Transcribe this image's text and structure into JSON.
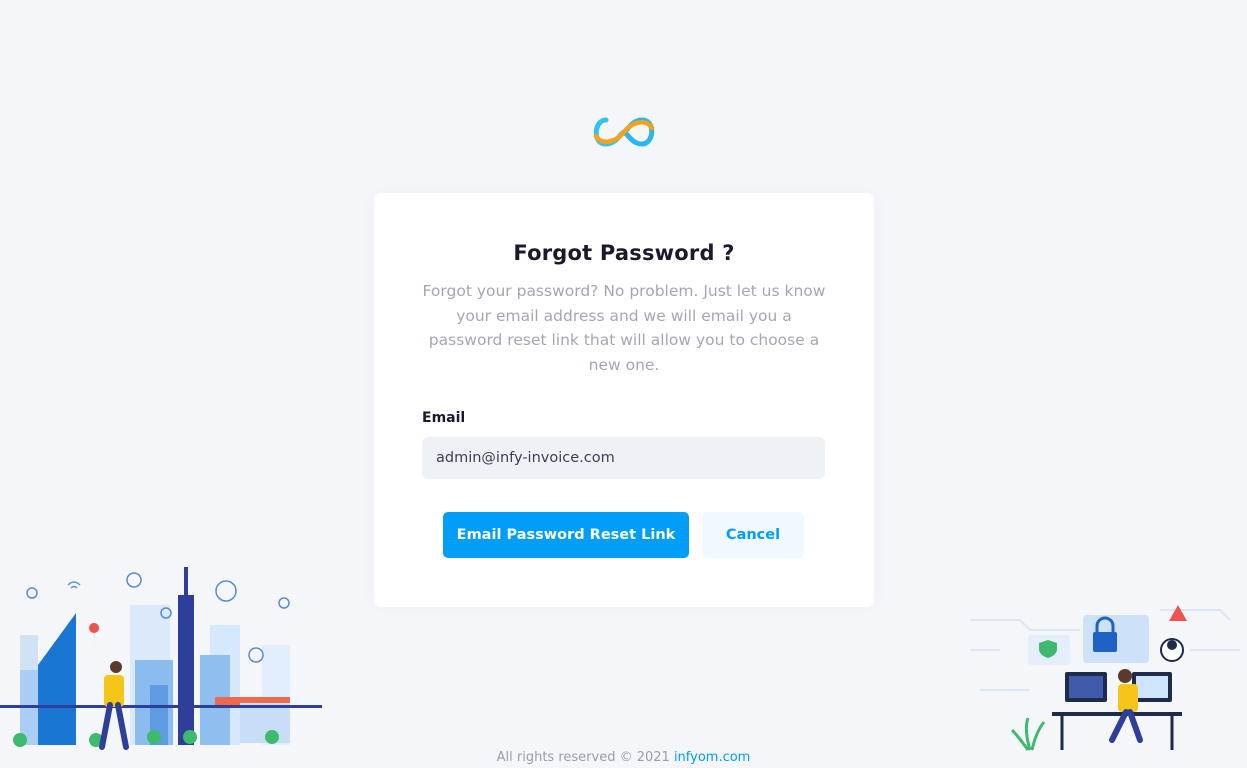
{
  "logo": {
    "icon": "infinity-logo-icon"
  },
  "card": {
    "title": "Forgot Password ?",
    "description": "Forgot your password? No problem. Just let us know your email address and we will email you a password reset link that will allow you to choose a new one.",
    "email_label": "Email",
    "email_value": "admin@infy-invoice.com",
    "submit_label": "Email Password Reset Link",
    "cancel_label": "Cancel"
  },
  "footer": {
    "text": "All rights reserved © 2021 ",
    "link_text": "infyom.com"
  },
  "colors": {
    "accent": "#009ef7",
    "background": "#f5f6f9",
    "input_bg": "#eef1f5"
  }
}
